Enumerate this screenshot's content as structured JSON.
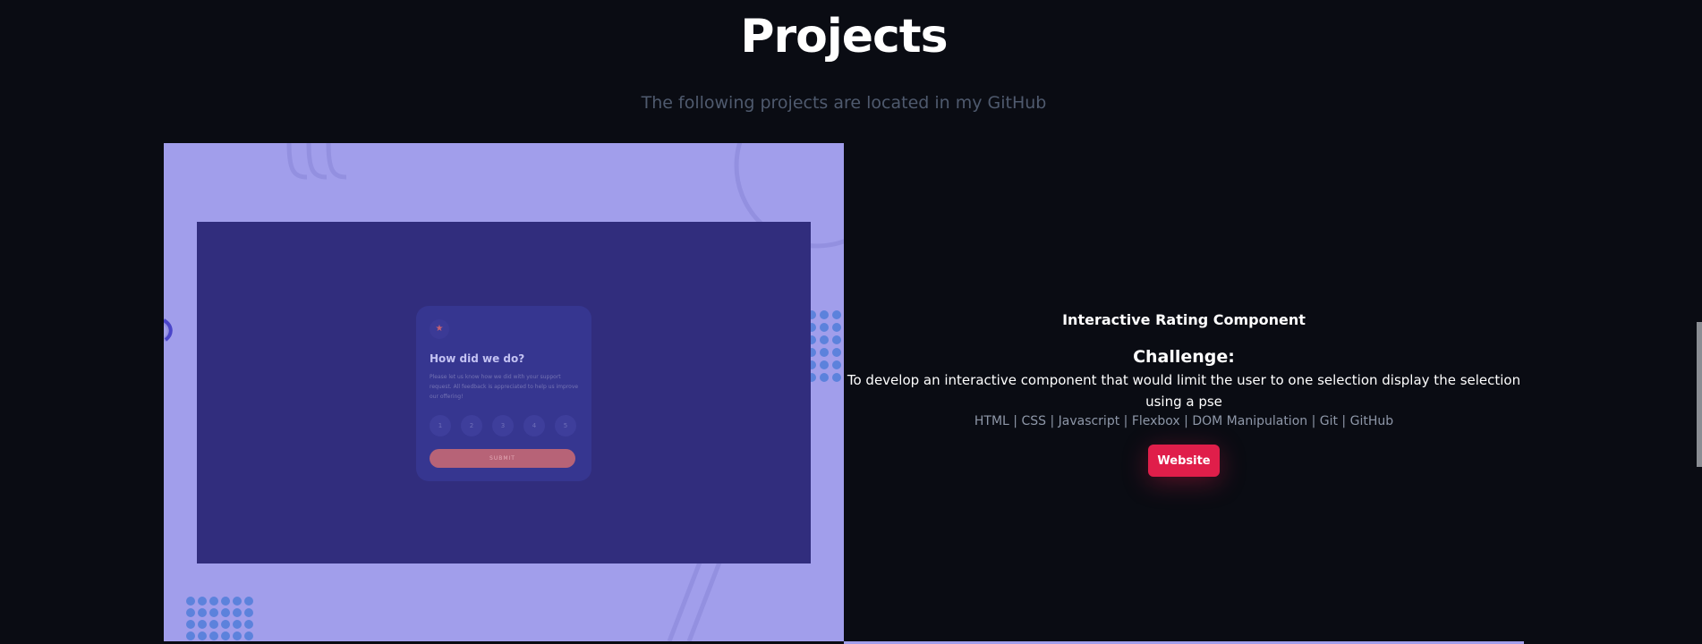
{
  "header": {
    "title": "Projects",
    "subtitle": "The following projects are located in my GitHub"
  },
  "project": {
    "name": "Interactive Rating Component",
    "challenge_heading": "Challenge:",
    "challenge_text": "To develop an interactive component that would limit the user to one selection display the selection using a pse",
    "technologies": "HTML | CSS | Javascript | Flexbox | DOM Manipulation | Git | GitHub",
    "website_label": "Website",
    "screenshot": {
      "card_icon": "star-icon",
      "card_title": "How did we do?",
      "card_description": "Please let us know how we did with your support request. All feedback is appreciated to help us improve our offering!",
      "ratings": [
        "1",
        "2",
        "3",
        "4",
        "5"
      ],
      "submit_label": "SUBMIT"
    }
  },
  "colors": {
    "background": "#0a0c13",
    "accent": "#e01e4a",
    "image_background": "#a19eeb",
    "mock_background": "#312d7d"
  }
}
